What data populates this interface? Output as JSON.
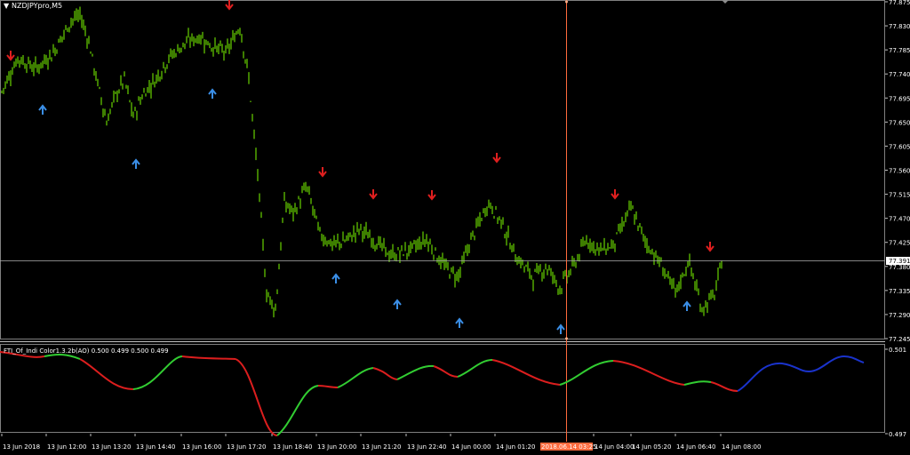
{
  "window": {
    "symbol_label": "NZDJPYpro,M5",
    "background": "#000000",
    "candle_color": "#7CFC00",
    "grid_color": "#c0c0c0"
  },
  "price_axis": {
    "ticks": [
      "77.875",
      "77.830",
      "77.785",
      "77.740",
      "77.695",
      "77.650",
      "77.605",
      "77.560",
      "77.515",
      "77.470",
      "77.425",
      "77.380",
      "77.335",
      "77.290",
      "77.245"
    ],
    "current_price": "77.391",
    "current_price_label_bg": "#ffffff"
  },
  "time_axis": {
    "ticks": [
      "13 Jun 2018",
      "13 Jun 12:00",
      "13 Jun 13:20",
      "13 Jun 14:40",
      "13 Jun 16:00",
      "13 Jun 17:20",
      "13 Jun 18:40",
      "13 Jun 20:00",
      "13 Jun 21:20",
      "13 Jun 22:40",
      "14 Jun 00:00",
      "14 Jun 01:20",
      "2018.06.14 03:25",
      "14 Jun 04:00",
      "14 Jun 05:20",
      "14 Jun 06:40",
      "14 Jun 08:00"
    ],
    "crosshair_label": "2018.06.14 03:25",
    "crosshair_color": "#ff6a3d"
  },
  "indicator": {
    "label": "FTI_Of_Indi Color1.3.2b(AO) 0.500 0.499 0.500 0.499",
    "axis_top": "0.501",
    "axis_bottom": "0.497",
    "colors": {
      "up": "#32cd32",
      "down": "#dc1e1e",
      "future": "#1a33cc"
    }
  },
  "arrows": {
    "up_color": "#3a8ee6",
    "down_color": "#e01f1f",
    "up_icon": "arrow-up-icon",
    "down_icon": "arrow-down-icon"
  },
  "chart_data": {
    "type": "candlestick",
    "price_series_note": "",
    "close_points": [
      [
        0,
        77.7
      ],
      [
        20,
        77.77
      ],
      [
        40,
        77.75
      ],
      [
        60,
        77.78
      ],
      [
        80,
        77.84
      ],
      [
        90,
        77.85
      ],
      [
        100,
        77.8
      ],
      [
        110,
        77.72
      ],
      [
        120,
        77.65
      ],
      [
        130,
        77.7
      ],
      [
        140,
        77.73
      ],
      [
        150,
        77.66
      ],
      [
        160,
        77.7
      ],
      [
        175,
        77.73
      ],
      [
        190,
        77.77
      ],
      [
        210,
        77.8
      ],
      [
        225,
        77.81
      ],
      [
        240,
        77.79
      ],
      [
        255,
        77.78
      ],
      [
        270,
        77.83
      ],
      [
        280,
        77.73
      ],
      [
        290,
        77.55
      ],
      [
        300,
        77.33
      ],
      [
        310,
        77.3
      ],
      [
        320,
        77.5
      ],
      [
        330,
        77.48
      ],
      [
        345,
        77.53
      ],
      [
        360,
        77.44
      ],
      [
        375,
        77.42
      ],
      [
        390,
        77.43
      ],
      [
        405,
        77.45
      ],
      [
        420,
        77.43
      ],
      [
        440,
        77.4
      ],
      [
        460,
        77.41
      ],
      [
        480,
        77.43
      ],
      [
        500,
        77.38
      ],
      [
        515,
        77.36
      ],
      [
        530,
        77.43
      ],
      [
        550,
        77.5
      ],
      [
        565,
        77.46
      ],
      [
        580,
        77.4
      ],
      [
        600,
        77.36
      ],
      [
        615,
        77.38
      ],
      [
        630,
        77.34
      ],
      [
        645,
        77.38
      ],
      [
        660,
        77.43
      ],
      [
        675,
        77.41
      ],
      [
        690,
        77.42
      ],
      [
        710,
        77.49
      ],
      [
        725,
        77.43
      ],
      [
        745,
        77.38
      ],
      [
        760,
        77.33
      ],
      [
        775,
        77.39
      ],
      [
        790,
        77.3
      ],
      [
        805,
        77.33
      ],
      [
        812,
        77.39
      ]
    ],
    "down_arrows_x": [
      12,
      258,
      363,
      420,
      486,
      559,
      692,
      799
    ],
    "up_arrows_x": [
      48,
      153,
      239,
      378,
      447,
      517,
      631,
      773
    ],
    "ylim": [
      77.245,
      77.875
    ]
  }
}
